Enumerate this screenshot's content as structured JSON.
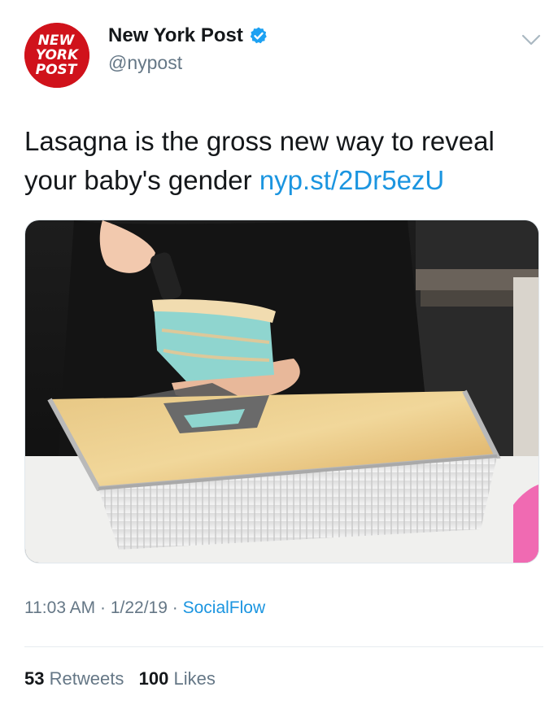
{
  "account": {
    "display_name": "New York Post",
    "handle": "@nypost",
    "verified": true,
    "avatar_lines": [
      "NEW",
      "YORK",
      "POST"
    ],
    "avatar_color": "#d0121b"
  },
  "tweet": {
    "text": "Lasagna is the gross new way to reveal your baby's gender ",
    "link": "nyp.st/2Dr5ezU",
    "media_icon": "lasagna-photo"
  },
  "meta": {
    "time": "11:03 AM",
    "separator": " · ",
    "date": "1/22/19",
    "source": "SocialFlow"
  },
  "stats": {
    "retweets_count": "53",
    "retweets_label": "Retweets",
    "likes_count": "100",
    "likes_label": "Likes"
  },
  "colors": {
    "link": "#1b95e0",
    "secondary_text": "#657786",
    "primary_text": "#14171a"
  }
}
